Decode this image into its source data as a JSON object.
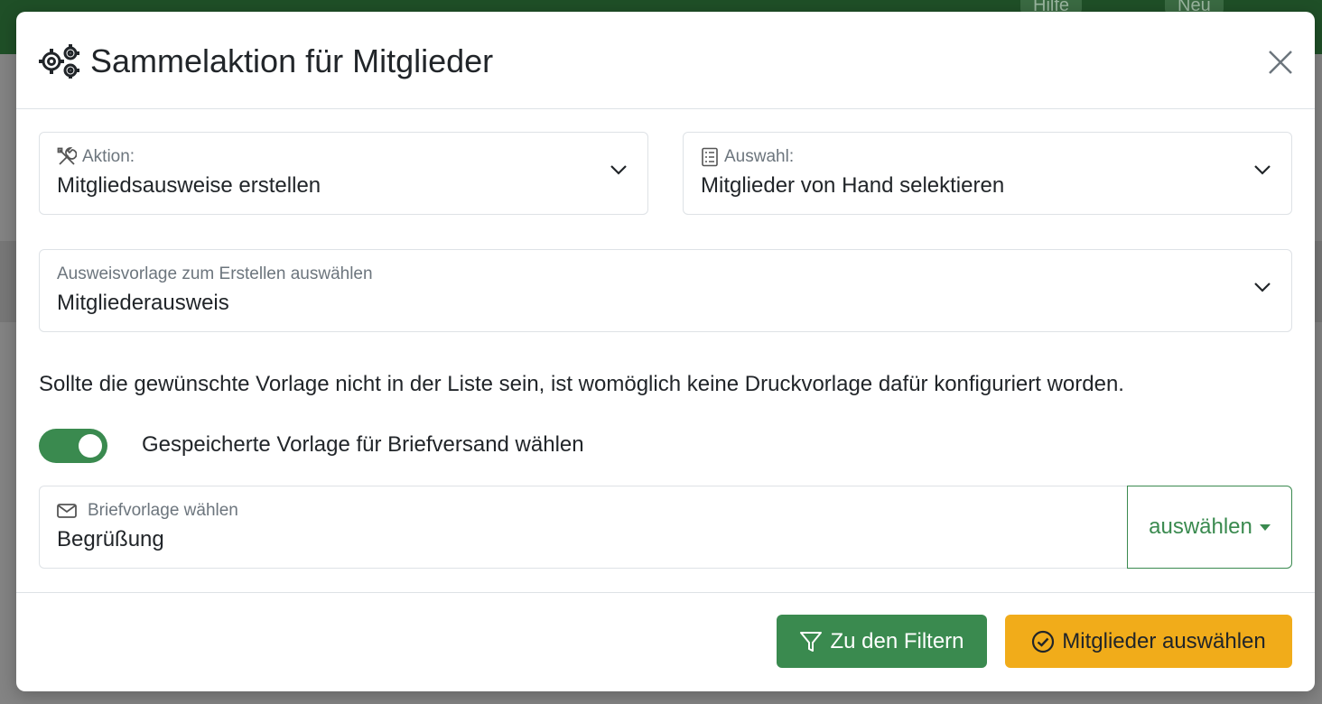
{
  "background": {
    "help_label": "Hilfe",
    "new_label": "Neu"
  },
  "modal": {
    "title": "Sammelaktion für Mitglieder",
    "title_icon": "gears-icon",
    "close_icon": "close-icon"
  },
  "action_select": {
    "label": "Aktion:",
    "value": "Mitgliedsausweise erstellen",
    "icon": "tools-icon"
  },
  "selection_select": {
    "label": "Auswahl:",
    "value": "Mitglieder von Hand selektieren",
    "icon": "list-icon"
  },
  "template_select": {
    "label": "Ausweisvorlage zum Erstellen auswählen",
    "value": "Mitgliederausweis"
  },
  "hint_text": "Sollte die gewünschte Vorlage nicht in der Liste sein, ist womöglich keine Druckvorlage dafür konfiguriert worden.",
  "toggle": {
    "label": "Gespeicherte Vorlage für Briefversand wählen",
    "checked": true
  },
  "letter_template": {
    "label": "Briefvorlage wählen",
    "value": "Begrüßung",
    "icon": "envelope-icon",
    "dropdown_label": "auswählen"
  },
  "footer": {
    "filter_button": "Zu den Filtern",
    "select_button": "Mitglieder auswählen"
  },
  "colors": {
    "primary_green": "#3a8a4f",
    "warning_yellow": "#f1ac1a"
  }
}
